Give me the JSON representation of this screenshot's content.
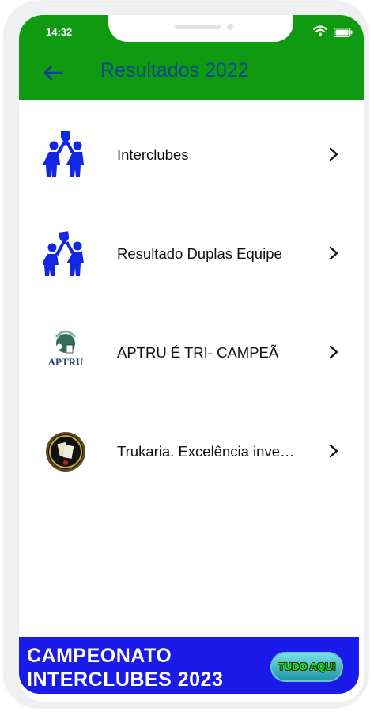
{
  "status_bar": {
    "time": "14:32",
    "wifi_icon": "wifi-icon",
    "battery_icon": "battery-icon"
  },
  "app_bar": {
    "title": "Resultados 2022",
    "back_icon": "arrow-left-icon"
  },
  "list": [
    {
      "label": "Interclubes",
      "icon": "trophy-team-icon"
    },
    {
      "label": "Resultado Duplas Equipe",
      "icon": "trophy-team-icon"
    },
    {
      "label": "APTRU É TRI- CAMPEÃ",
      "icon": "aptru-logo",
      "logo_text": "APTRU"
    },
    {
      "label": "Trukaria. Excelência inve…",
      "icon": "trukaria-logo"
    }
  ],
  "banner": {
    "line1": "CAMPEONATO",
    "line2": "INTERCLUBES 2023",
    "button_label": "TUDO AQUI"
  },
  "colors": {
    "app_bar": "#0f9a12",
    "title": "#0b3f9b",
    "icon_blue": "#1227e3",
    "banner": "#1a1aea"
  }
}
